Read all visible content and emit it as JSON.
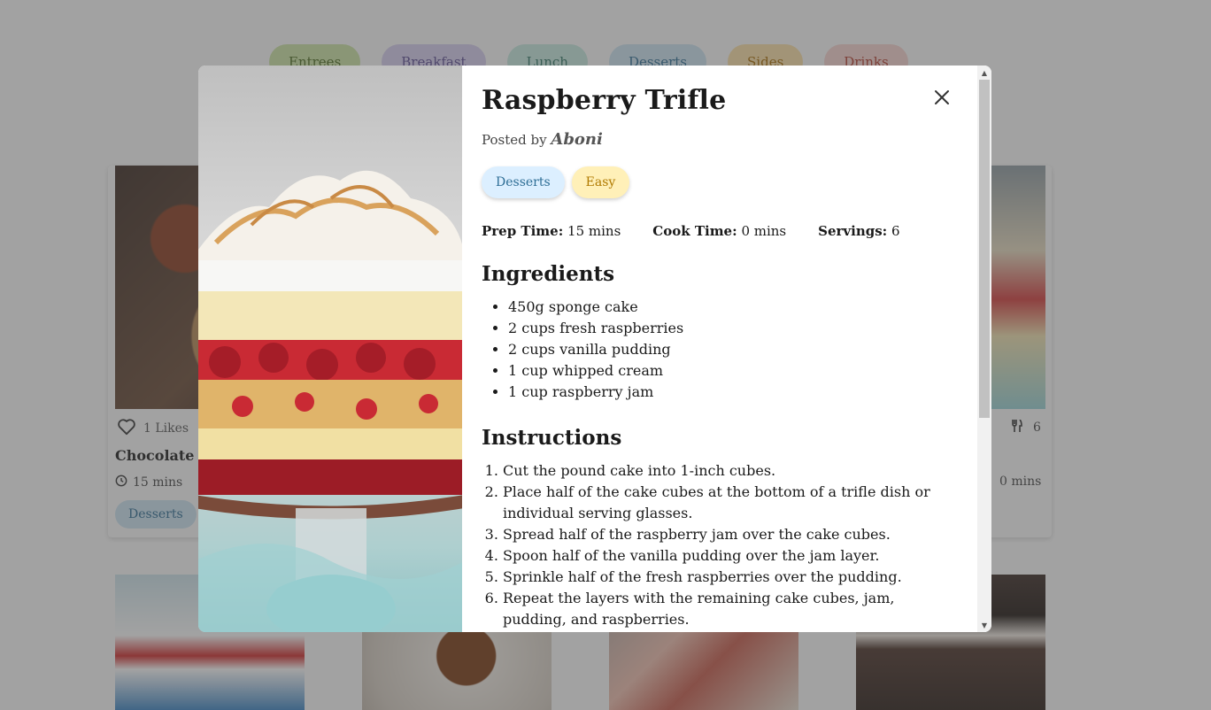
{
  "categories": [
    "Entrees",
    "Breakfast",
    "Lunch",
    "Desserts",
    "Sides",
    "Drinks"
  ],
  "cards": {
    "left": {
      "likes": "1 Likes",
      "title": "Chocolate Cl",
      "time": "15 mins",
      "tag": "Desserts"
    },
    "right": {
      "servings": "6",
      "time": "0 mins"
    }
  },
  "modal": {
    "title": "Raspberry Trifle",
    "posted_by_label": "Posted by",
    "author": "Aboni",
    "tags": [
      "Desserts",
      "Easy"
    ],
    "prep_label": "Prep Time:",
    "prep_value": "15 mins",
    "cook_label": "Cook Time:",
    "cook_value": "0 mins",
    "servings_label": "Servings:",
    "servings_value": "6",
    "ingredients_heading": "Ingredients",
    "ingredients": [
      "450g sponge cake",
      "2 cups fresh raspberries",
      "2 cups vanilla pudding",
      "1 cup whipped cream",
      "1 cup raspberry jam"
    ],
    "instructions_heading": "Instructions",
    "instructions": [
      "Cut the pound cake into 1-inch cubes.",
      "Place half of the cake cubes at the bottom of a trifle dish or individual serving glasses.",
      "Spread half of the raspberry jam over the cake cubes.",
      "Spoon half of the vanilla pudding over the jam layer.",
      "Sprinkle half of the fresh raspberries over the pudding.",
      "Repeat the layers with the remaining cake cubes, jam, pudding, and raspberries."
    ]
  }
}
